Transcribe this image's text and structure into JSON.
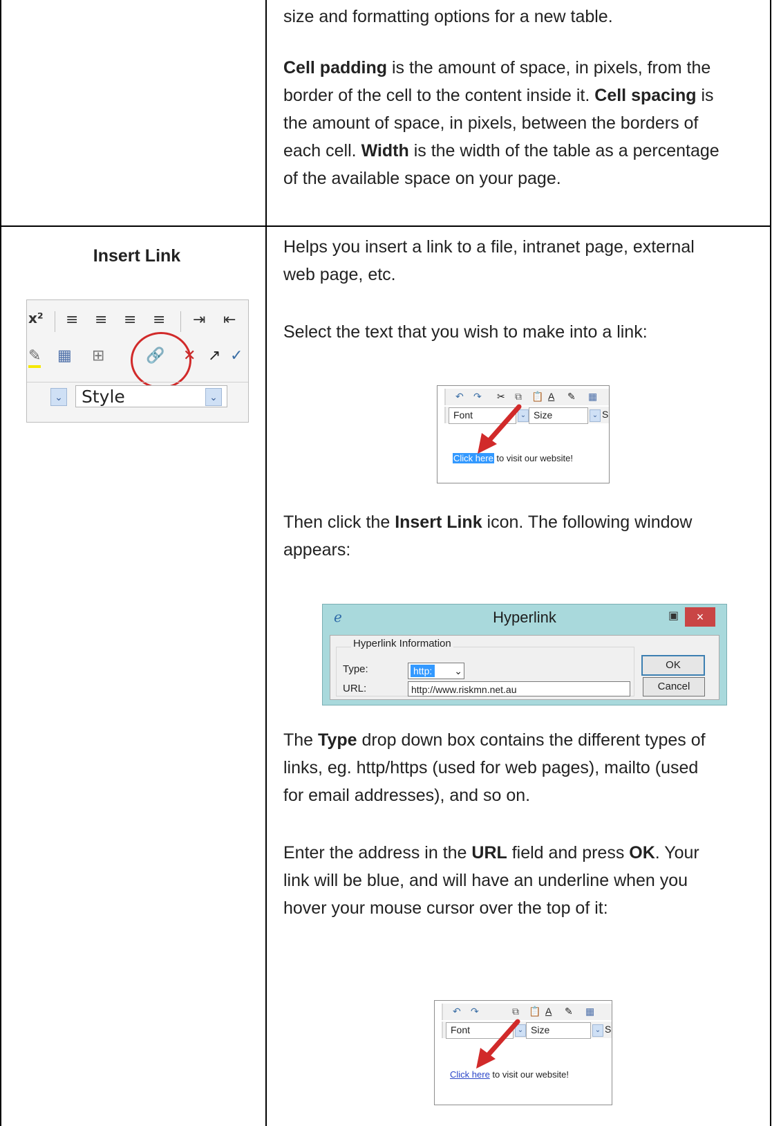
{
  "top_cell": {
    "line0": "size and formatting options for a new table.",
    "para2": {
      "t1_bold": "Cell padding",
      "t2": " is the amount of space, in pixels, from the",
      "t3": "border of the cell to the content inside it. ",
      "t4_bold": "Cell spacing",
      "t5": " is",
      "t6": "the amount of space, in pixels, between the borders of",
      "t7": "each cell. ",
      "t8_bold": "Width",
      "t9": " is the width of the table as a percentage",
      "t10": "of the available space on your page."
    }
  },
  "left": {
    "heading": "Insert Link",
    "toolbar": {
      "style_label": "Style",
      "superscript": "x²"
    }
  },
  "right": {
    "p1": "Helps you insert a link to a file, intranet page, external",
    "p1b": "web page, etc.",
    "p2": "Select the text that you wish to make into a link:",
    "p3a": "Then click the ",
    "p3b_bold": "Insert Link",
    "p3c": " icon. The following window",
    "p3d": "appears:",
    "p4a": "The ",
    "p4b_bold": "Type",
    "p4c": " drop down box contains the different types of",
    "p4d": "links, eg. http/https (used for web pages), mailto (used",
    "p4e": "for email addresses), and so on.",
    "p5a": "Enter the address in the ",
    "p5b_bold": "URL",
    "p5c": " field and press ",
    "p5d_bold": "OK",
    "p5e": ". Your",
    "p5f": "link will be blue, and will have an underline when you",
    "p5g": "hover your mouse cursor over the top of it:"
  },
  "editor1": {
    "font": "Font",
    "size": "Size",
    "s": "S",
    "link_text": "Click here",
    "rest_text": " to visit our website!"
  },
  "editor2": {
    "font": "Font",
    "size": "Size",
    "s": "S",
    "link_text": "Click here",
    "rest_text": " to visit our website!"
  },
  "dialog": {
    "title": "Hyperlink",
    "close": "×",
    "group_label": "Hyperlink Information",
    "type_label": "Type:",
    "type_value": "http:",
    "url_label": "URL:",
    "url_value": "http://www.riskmn.net.au",
    "ok": "OK",
    "cancel": "Cancel"
  },
  "colors": {
    "border": "#000000",
    "highlight": "#3399ff",
    "link": "#2a45c8",
    "dialog_bg": "#a9d9dc",
    "close_bg": "#c94545",
    "annotation_red": "#d12a2a"
  },
  "icons": [
    "undo-icon",
    "redo-icon",
    "cut-icon",
    "copy-icon",
    "paste-icon",
    "font-color-icon",
    "highlight-icon",
    "table-icon",
    "insert-link-icon",
    "remove-link-icon",
    "align-left-icon",
    "align-center-icon",
    "align-right-icon",
    "justify-icon",
    "indent-icon",
    "outdent-icon",
    "ie-icon"
  ]
}
